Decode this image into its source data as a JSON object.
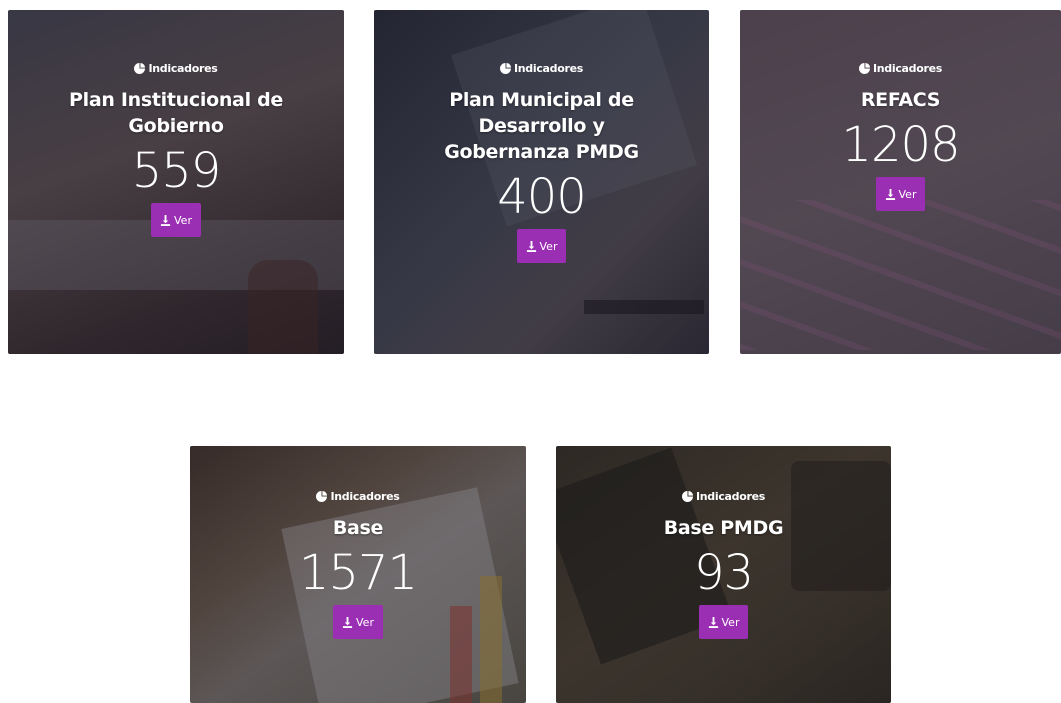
{
  "colors": {
    "button": "#9b2fb4",
    "text": "#ffffff"
  },
  "icons": {
    "tag": "pie-chart-icon",
    "button": "download-icon"
  },
  "cards": [
    {
      "tag": "Indicadores",
      "title": "Plan Institucional de Gobierno",
      "count": "559",
      "button": "Ver"
    },
    {
      "tag": "Indicadores",
      "title": "Plan Municipal de Desarrollo y Gobernanza PMDG",
      "count": "400",
      "button": "Ver"
    },
    {
      "tag": "Indicadores",
      "title": "REFACS",
      "count": "1208",
      "button": "Ver"
    },
    {
      "tag": "Indicadores",
      "title": "Base",
      "count": "1571",
      "button": "Ver"
    },
    {
      "tag": "Indicadores",
      "title": "Base PMDG",
      "count": "93",
      "button": "Ver"
    }
  ]
}
